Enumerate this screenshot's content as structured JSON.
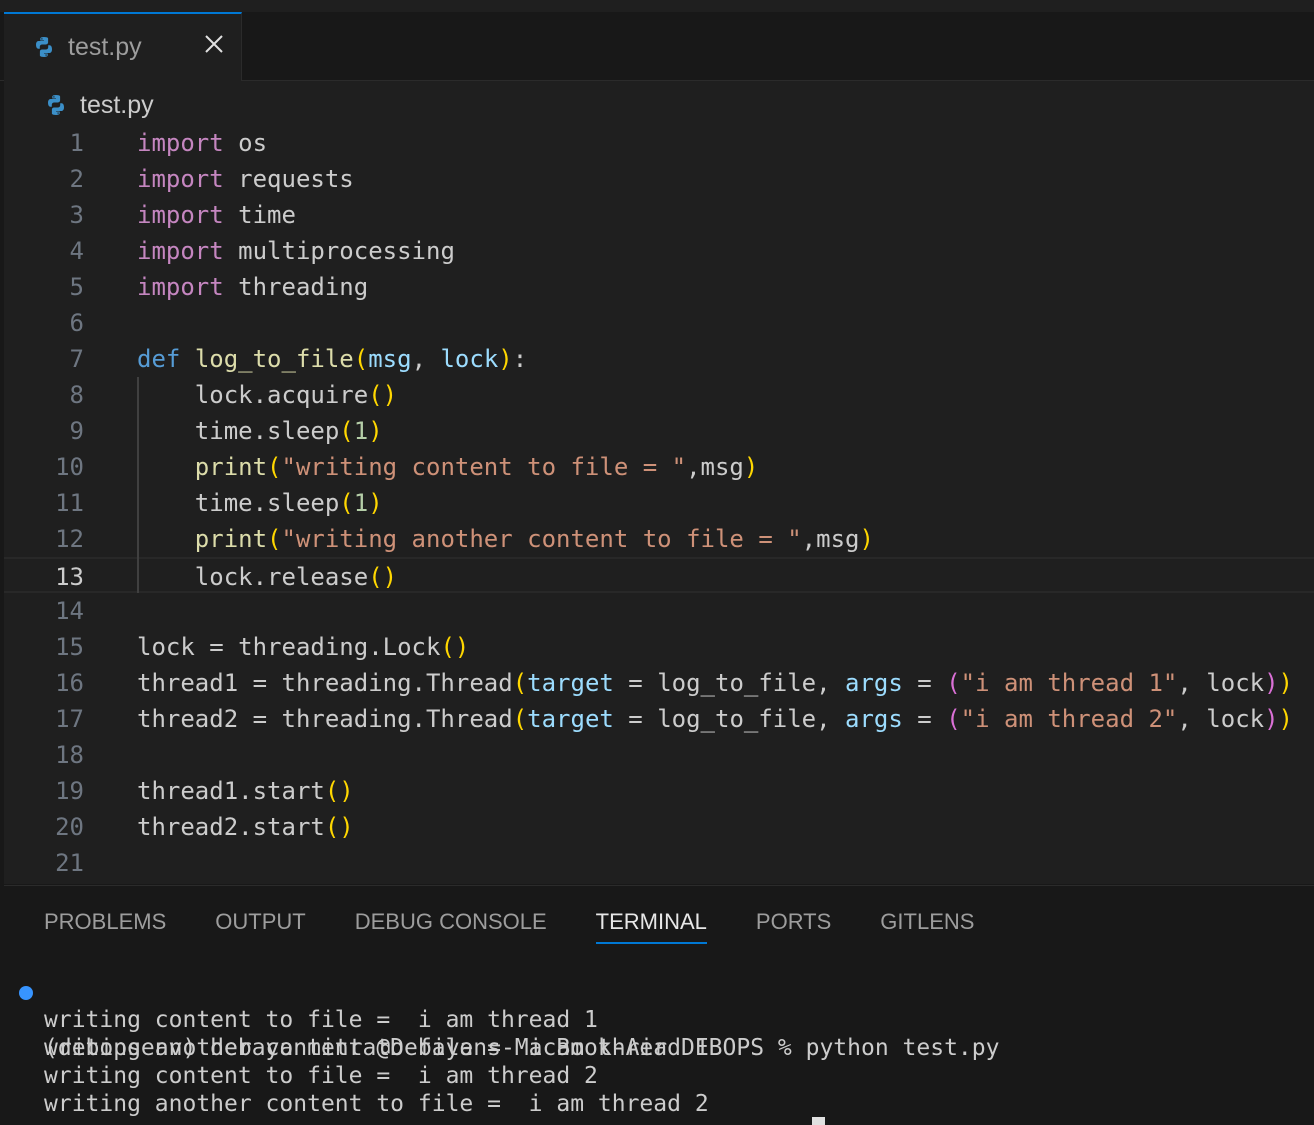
{
  "tab": {
    "label": "test.py"
  },
  "breadcrumb": {
    "label": "test.py"
  },
  "editor": {
    "current_line": 13,
    "lines": [
      {
        "n": "1",
        "tokens": [
          {
            "c": "kw",
            "t": "import"
          },
          {
            "c": "",
            "t": " os"
          }
        ]
      },
      {
        "n": "2",
        "tokens": [
          {
            "c": "kw",
            "t": "import"
          },
          {
            "c": "",
            "t": " requests"
          }
        ]
      },
      {
        "n": "3",
        "tokens": [
          {
            "c": "kw",
            "t": "import"
          },
          {
            "c": "",
            "t": " time"
          }
        ]
      },
      {
        "n": "4",
        "tokens": [
          {
            "c": "kw",
            "t": "import"
          },
          {
            "c": "",
            "t": " multiprocessing"
          }
        ]
      },
      {
        "n": "5",
        "tokens": [
          {
            "c": "kw",
            "t": "import"
          },
          {
            "c": "",
            "t": " threading"
          }
        ]
      },
      {
        "n": "6",
        "tokens": []
      },
      {
        "n": "7",
        "tokens": [
          {
            "c": "def",
            "t": "def"
          },
          {
            "c": "",
            "t": " "
          },
          {
            "c": "fn",
            "t": "log_to_file"
          },
          {
            "c": "b1",
            "t": "("
          },
          {
            "c": "par",
            "t": "msg"
          },
          {
            "c": "",
            "t": ", "
          },
          {
            "c": "par",
            "t": "lock"
          },
          {
            "c": "b1",
            "t": ")"
          },
          {
            "c": "",
            "t": ":"
          }
        ]
      },
      {
        "n": "8",
        "tokens": [
          {
            "c": "",
            "t": "    lock.acquire"
          },
          {
            "c": "b1",
            "t": "()"
          }
        ]
      },
      {
        "n": "9",
        "tokens": [
          {
            "c": "",
            "t": "    time.sleep"
          },
          {
            "c": "b1",
            "t": "("
          },
          {
            "c": "num",
            "t": "1"
          },
          {
            "c": "b1",
            "t": ")"
          }
        ]
      },
      {
        "n": "10",
        "tokens": [
          {
            "c": "",
            "t": "    "
          },
          {
            "c": "fn",
            "t": "print"
          },
          {
            "c": "b1",
            "t": "("
          },
          {
            "c": "str",
            "t": "\"writing content to file = \""
          },
          {
            "c": "",
            "t": ",msg"
          },
          {
            "c": "b1",
            "t": ")"
          }
        ]
      },
      {
        "n": "11",
        "tokens": [
          {
            "c": "",
            "t": "    time.sleep"
          },
          {
            "c": "b1",
            "t": "("
          },
          {
            "c": "num",
            "t": "1"
          },
          {
            "c": "b1",
            "t": ")"
          }
        ]
      },
      {
        "n": "12",
        "tokens": [
          {
            "c": "",
            "t": "    "
          },
          {
            "c": "fn",
            "t": "print"
          },
          {
            "c": "b1",
            "t": "("
          },
          {
            "c": "str",
            "t": "\"writing another content to file = \""
          },
          {
            "c": "",
            "t": ",msg"
          },
          {
            "c": "b1",
            "t": ")"
          }
        ]
      },
      {
        "n": "13",
        "tokens": [
          {
            "c": "",
            "t": "    lock.release"
          },
          {
            "c": "b1",
            "t": "()"
          }
        ]
      },
      {
        "n": "14",
        "tokens": []
      },
      {
        "n": "15",
        "tokens": [
          {
            "c": "",
            "t": "lock = threading.Lock"
          },
          {
            "c": "b1",
            "t": "()"
          }
        ]
      },
      {
        "n": "16",
        "tokens": [
          {
            "c": "",
            "t": "thread1 = threading.Thread"
          },
          {
            "c": "b1",
            "t": "("
          },
          {
            "c": "par",
            "t": "target"
          },
          {
            "c": "",
            "t": " = log_to_file, "
          },
          {
            "c": "par",
            "t": "args"
          },
          {
            "c": "",
            "t": " = "
          },
          {
            "c": "b2",
            "t": "("
          },
          {
            "c": "str",
            "t": "\"i am thread 1\""
          },
          {
            "c": "",
            "t": ", lock"
          },
          {
            "c": "b2",
            "t": ")"
          },
          {
            "c": "b1",
            "t": ")"
          }
        ]
      },
      {
        "n": "17",
        "tokens": [
          {
            "c": "",
            "t": "thread2 = threading.Thread"
          },
          {
            "c": "b1",
            "t": "("
          },
          {
            "c": "par",
            "t": "target"
          },
          {
            "c": "",
            "t": " = log_to_file, "
          },
          {
            "c": "par",
            "t": "args"
          },
          {
            "c": "",
            "t": " = "
          },
          {
            "c": "b2",
            "t": "("
          },
          {
            "c": "str",
            "t": "\"i am thread 2\""
          },
          {
            "c": "",
            "t": ", lock"
          },
          {
            "c": "b2",
            "t": ")"
          },
          {
            "c": "b1",
            "t": ")"
          }
        ]
      },
      {
        "n": "18",
        "tokens": []
      },
      {
        "n": "19",
        "tokens": [
          {
            "c": "",
            "t": "thread1.start"
          },
          {
            "c": "b1",
            "t": "()"
          }
        ]
      },
      {
        "n": "20",
        "tokens": [
          {
            "c": "",
            "t": "thread2.start"
          },
          {
            "c": "b1",
            "t": "()"
          }
        ]
      },
      {
        "n": "21",
        "tokens": []
      }
    ]
  },
  "panel": {
    "tabs": [
      "PROBLEMS",
      "OUTPUT",
      "DEBUG CONSOLE",
      "TERMINAL",
      "PORTS",
      "GITLENS"
    ],
    "active_tab": "TERMINAL"
  },
  "terminal": {
    "prompt": "(debopsenv) debayanmitra@Debayans-MacBook-Air DEBOPS % python test.py",
    "output": [
      "writing content to file =  i am thread 1",
      "writing another content to file =  i am thread 1",
      "writing content to file =  i am thread 2",
      "writing another content to file =  i am thread 2"
    ]
  },
  "colors": {
    "accent": "#0078d4",
    "keyword": "#c586c0",
    "function": "#dcdcaa",
    "string": "#ce9178",
    "param": "#9cdcfe",
    "bracket1": "#ffd700",
    "bracket2": "#da70d6",
    "terminal_dot": "#3794ff"
  }
}
